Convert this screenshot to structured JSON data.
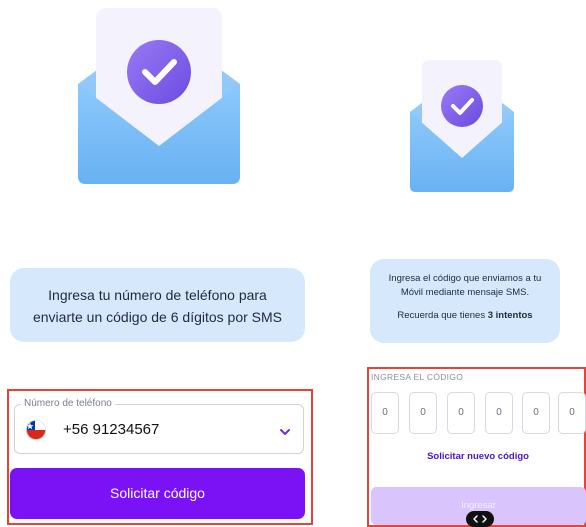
{
  "left": {
    "illustration_icon": "envelope-check-icon",
    "info_text": [
      "Ingresa tu número de teléfono para",
      "enviarte un código de 6 dígitos por SMS"
    ],
    "phone_field": {
      "label": "Número de teléfono",
      "country_flag_icon": "chile-flag-icon",
      "value": "+56 91234567",
      "dropdown_icon": "chevron-down-icon"
    },
    "request_button_label": "Solicitar código"
  },
  "right": {
    "illustration_icon": "envelope-check-icon",
    "info_lines": [
      "Ingresa el código que enviamos a tu",
      "Móvil mediante mensaje SMS."
    ],
    "reminder_prefix": "Recuerda que tienes ",
    "attempts": "3 intentos",
    "code_label": "INGRESA EL CÓDIGO",
    "code_digits": [
      "0",
      "0",
      "0",
      "0",
      "0",
      "0"
    ],
    "resend_link": "Solicitar nuevo código",
    "submit_label": "Ingresar",
    "handle_icon": "code-handle-icon"
  },
  "colors": {
    "primary": "#7b12f5",
    "primary_disabled": "#d9c5fb",
    "info_bg": "#d6e8fb",
    "highlight": "#e0463a",
    "link": "#4b14c7"
  }
}
